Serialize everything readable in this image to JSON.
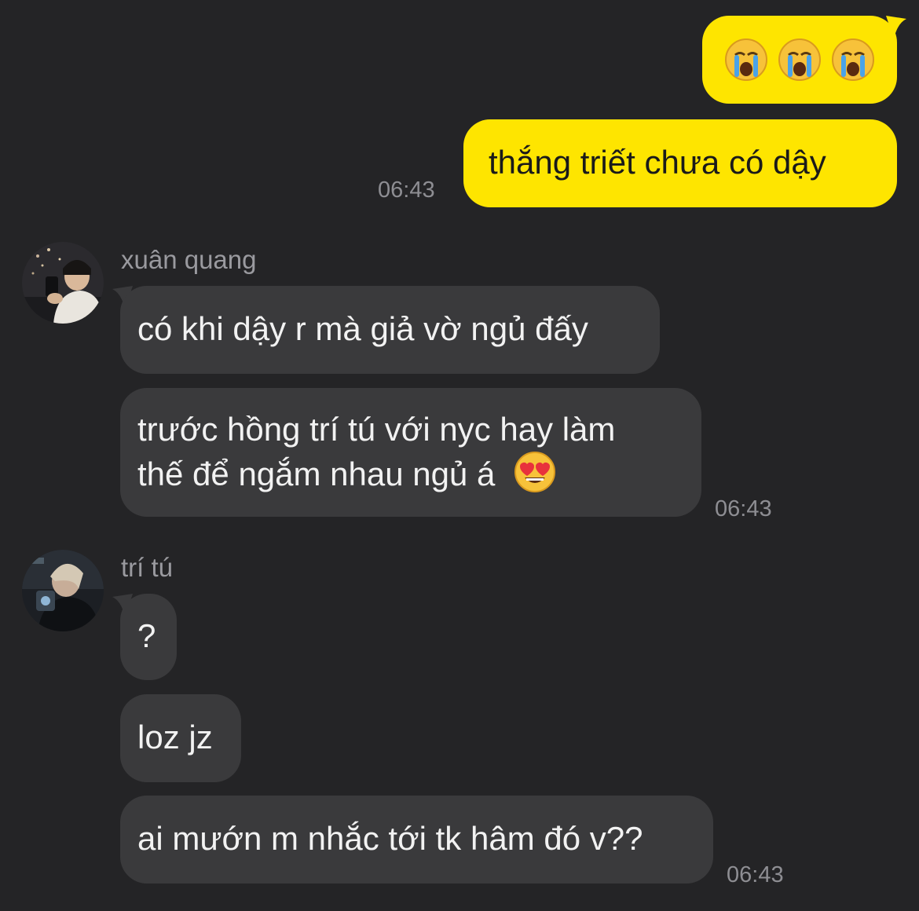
{
  "messages": {
    "outgoing": {
      "emoji_reaction": "😭😭😭",
      "text": "thắng triết chưa có dậy",
      "time": "06:43"
    },
    "group_xuan_quang": {
      "sender": "xuân quang",
      "msg1": "có khi dậy r mà giả vờ ngủ đấy",
      "msg2_line1": "trước hồng trí tú với nyc hay làm",
      "msg2_line2": "thế để ngắm nhau ngủ á",
      "msg2_emoji": "😍",
      "time": "06:43"
    },
    "group_tri_tu": {
      "sender": "trí tú",
      "msg1": "?",
      "msg2": "loz jz",
      "msg3": "ai mướn m nhắc tới tk hâm đó v??",
      "time": "06:43"
    }
  },
  "colors": {
    "background": "#242426",
    "outgoing_bubble": "#fee500",
    "incoming_bubble": "#3a3a3c",
    "timestamp": "#8e8e93"
  }
}
